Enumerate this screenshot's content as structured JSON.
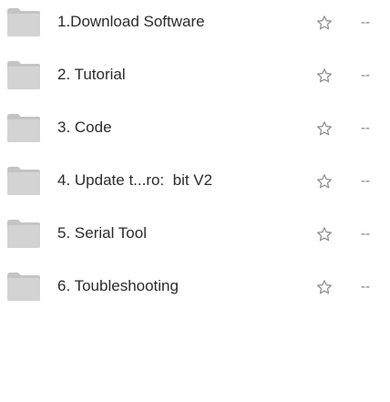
{
  "folder_list": {
    "items": [
      {
        "name": "1.Download Software",
        "size": "--"
      },
      {
        "name": "2. Tutorial",
        "size": "--"
      },
      {
        "name": "3. Code",
        "size": "--"
      },
      {
        "name": "4. Update t...ro:  bit V2",
        "size": "--"
      },
      {
        "name": "5. Serial Tool",
        "size": "--"
      },
      {
        "name": "6. Toubleshooting",
        "size": "--"
      }
    ],
    "icons": {
      "item_icon": "folder-icon",
      "action_icon": "star-icon"
    },
    "colors": {
      "folder_front": "#d3d3d3",
      "folder_back": "#c4c4c4",
      "star_stroke": "#8a8a8a",
      "text": "#2b2b2b",
      "muted": "#7a7a7a"
    }
  }
}
